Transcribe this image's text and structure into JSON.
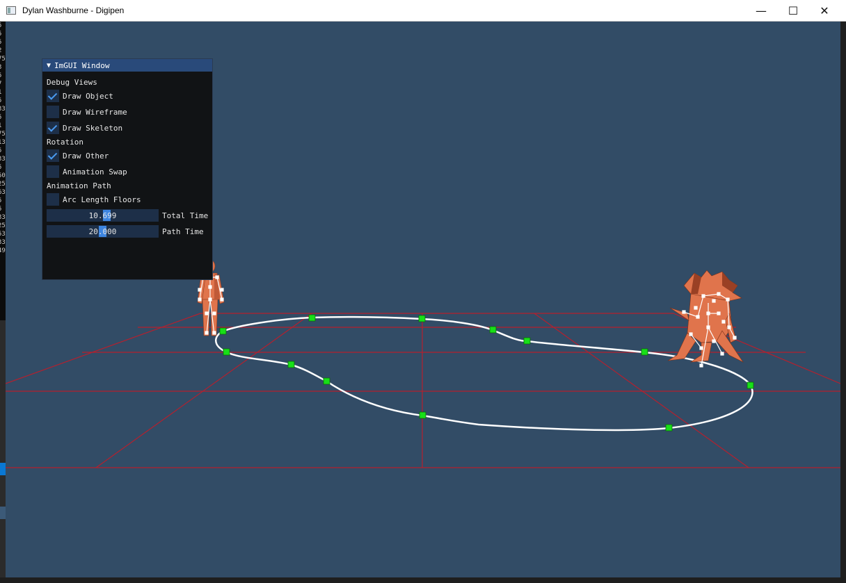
{
  "window": {
    "title": "Dylan Washburne - Digipen",
    "minimize_glyph": "—",
    "maximize_glyph": "☐",
    "close_glyph": "✕"
  },
  "console_digits": [
    "5",
    "5",
    "5",
    "2",
    "75",
    "3",
    "5",
    "7",
    "1",
    "5",
    "33",
    "5",
    "1",
    "75",
    "13",
    "5",
    "33",
    "5",
    "50",
    "25",
    "63",
    "5",
    "5",
    "33",
    "25",
    "53",
    "33",
    "49"
  ],
  "imgui": {
    "title": "ImGUI Window",
    "collapse_glyph": "▼",
    "sections": {
      "debug_views": "Debug Views",
      "rotation": "Rotation",
      "animation_path": "Animation Path"
    },
    "checkboxes": {
      "draw_object": {
        "label": "Draw Object",
        "checked": true
      },
      "draw_wireframe": {
        "label": "Draw Wireframe",
        "checked": false
      },
      "draw_skeleton": {
        "label": "Draw Skeleton",
        "checked": true
      },
      "draw_other": {
        "label": "Draw Other",
        "checked": true
      },
      "animation_swap": {
        "label": "Animation Swap",
        "checked": false
      },
      "arc_length_floors": {
        "label": "Arc Length Floors",
        "checked": false
      }
    },
    "sliders": {
      "total_time": {
        "label": "Total Time",
        "value": "10.699"
      },
      "path_time": {
        "label": "Path Time",
        "value": "20.000"
      }
    }
  },
  "colors": {
    "viewport_bg": "#324c66",
    "grid": "#b4202e",
    "path": "#ffffff",
    "control_point": "#18e018",
    "character": "#e0744c",
    "imgui_header": "#294a7a",
    "imgui_accent": "#4a9aef"
  }
}
